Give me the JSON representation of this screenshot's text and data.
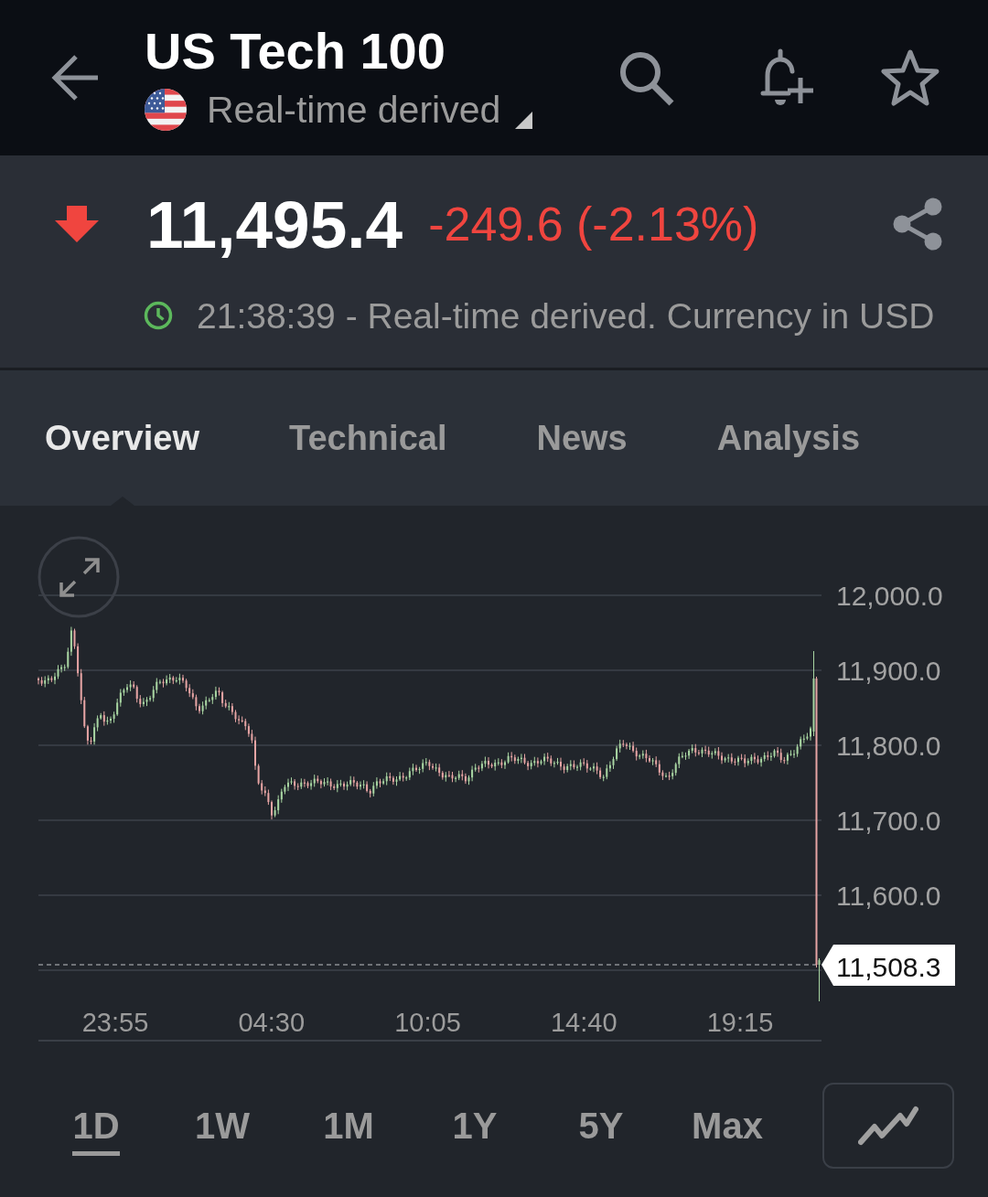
{
  "header": {
    "title": "US Tech 100",
    "subtitle": "Real-time derived"
  },
  "quote": {
    "falling": true,
    "price": "11,495.4",
    "change": "-249.6 (-2.13%)",
    "status": "21:38:39 - Real-time derived. Currency in USD"
  },
  "tabs": [
    {
      "label": "Overview",
      "selected": true
    },
    {
      "label": "Technical",
      "selected": false
    },
    {
      "label": "News",
      "selected": false
    },
    {
      "label": "Analysis",
      "selected": false
    }
  ],
  "chart": {
    "y_axis_labels": [
      "12,000.0",
      "11,900.0",
      "11,800.0",
      "11,700.0",
      "11,600.0"
    ],
    "last_price": "11,508.3",
    "x_axis_labels": [
      "23:55",
      "04:30",
      "10:05",
      "14:40",
      "19:15"
    ]
  },
  "ranges": [
    {
      "label": "1D",
      "selected": true
    },
    {
      "label": "1W",
      "selected": false
    },
    {
      "label": "1M",
      "selected": false
    },
    {
      "label": "1Y",
      "selected": false
    },
    {
      "label": "5Y",
      "selected": false
    },
    {
      "label": "Max",
      "selected": false
    }
  ]
}
